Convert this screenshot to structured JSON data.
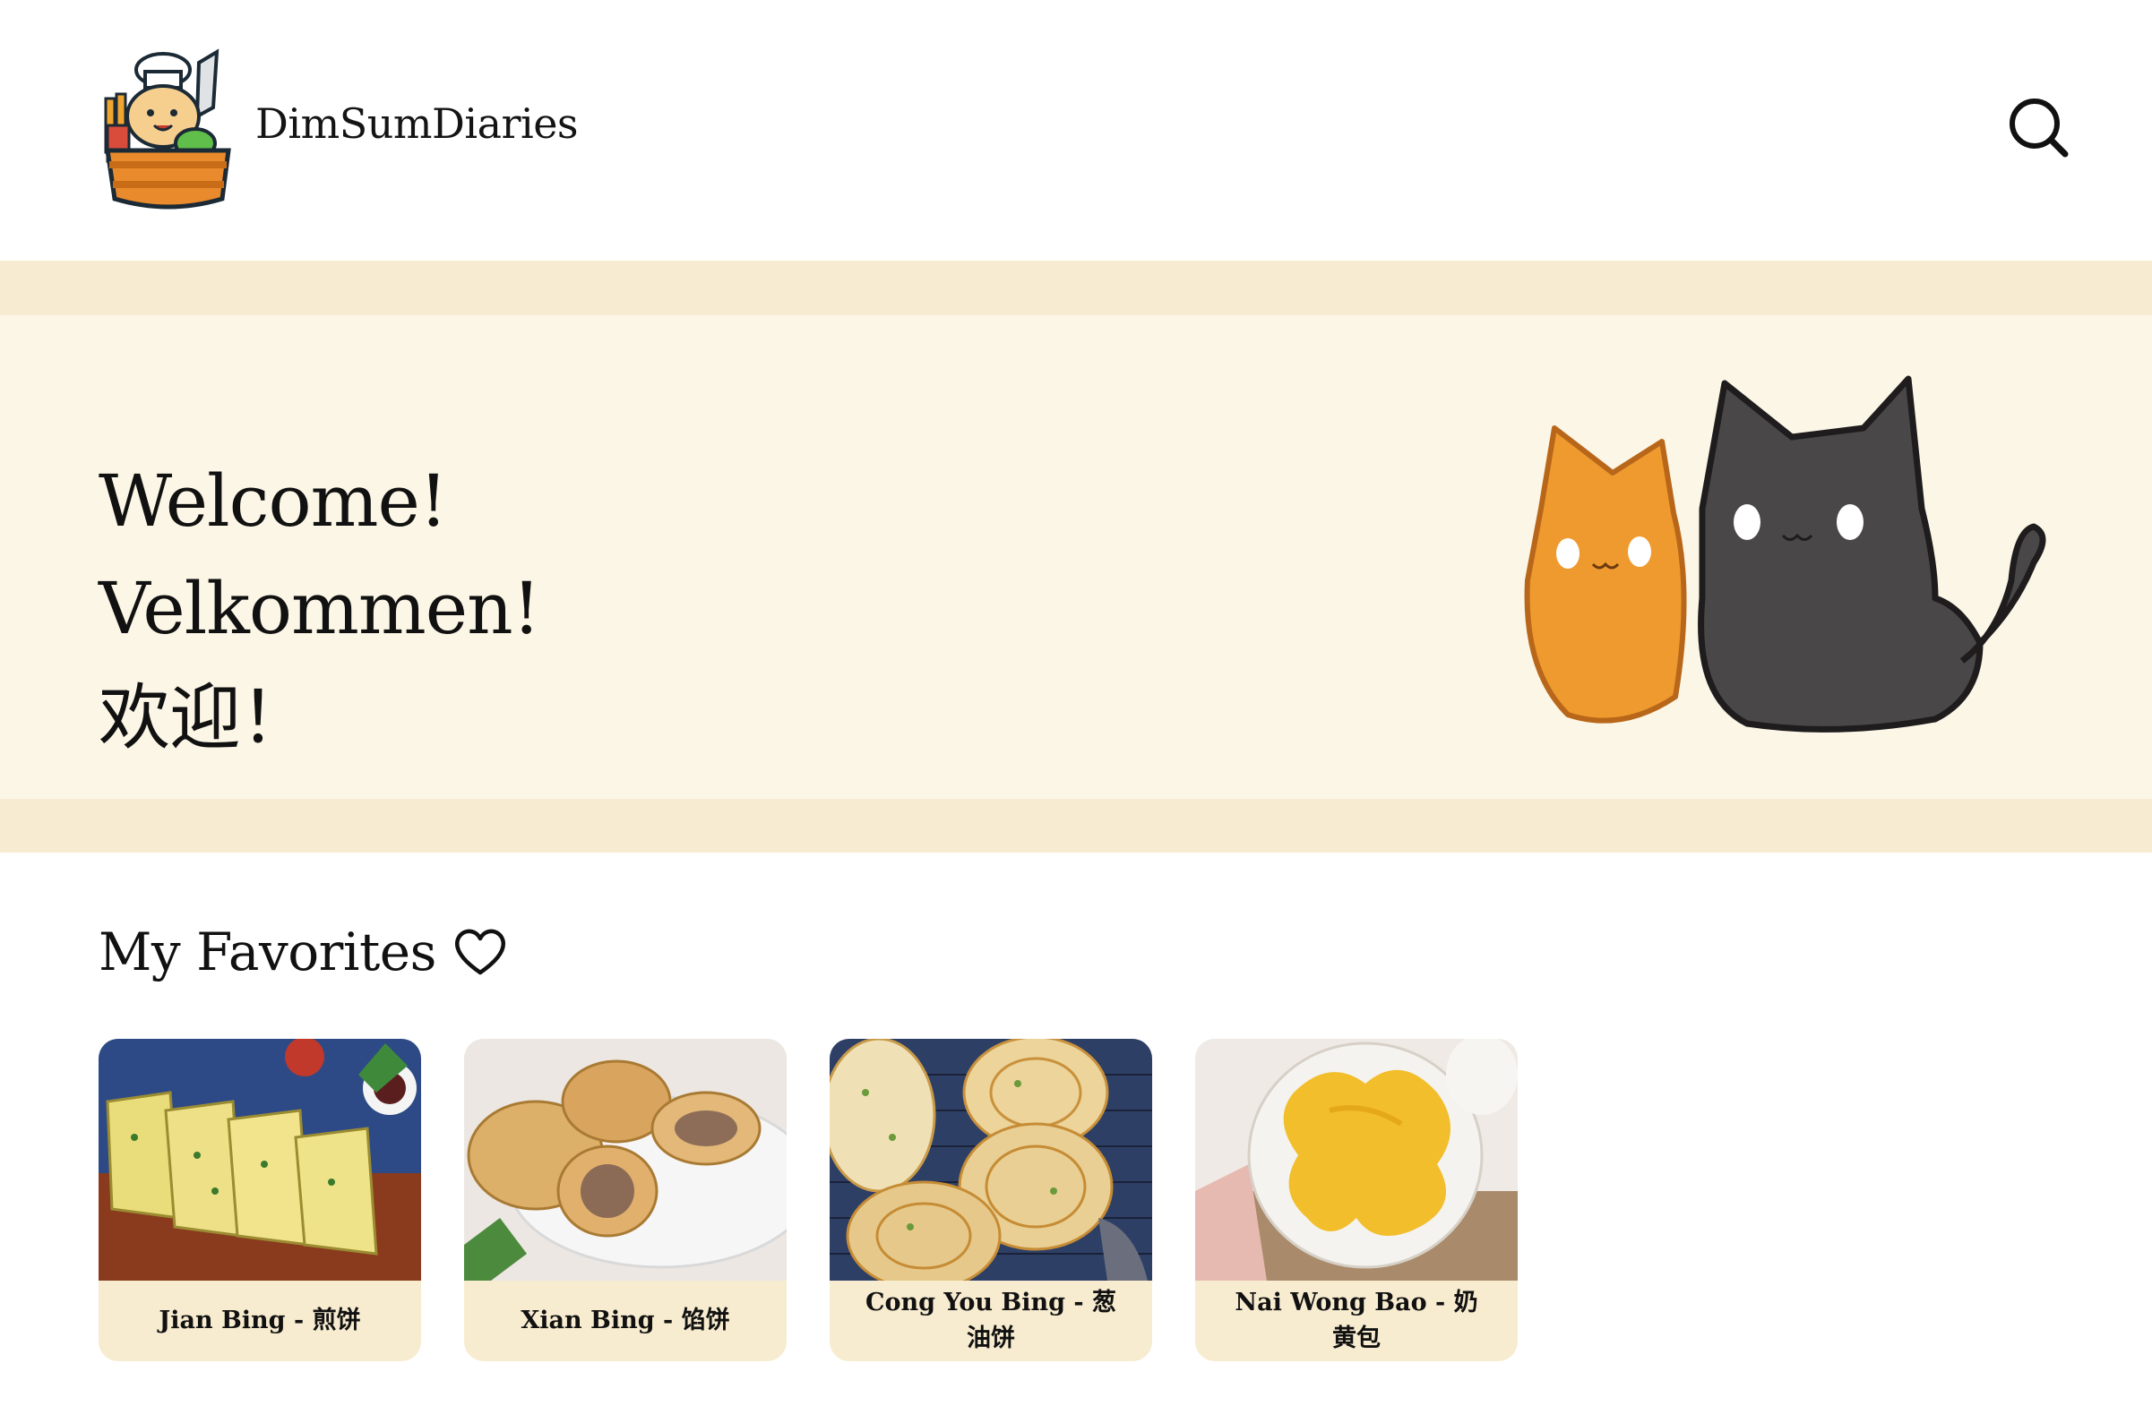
{
  "header": {
    "site_name": "DimSumDiaries",
    "logo_icon": "chef-dumpling-logo",
    "search_icon": "search-icon"
  },
  "hero": {
    "greetings": [
      "Welcome!",
      "Velkommen!",
      "欢迎！"
    ],
    "illustration": "two-cats-illustration"
  },
  "favorites": {
    "title": "My Favorites",
    "icon": "heart-icon",
    "cards": [
      {
        "label": "Jian Bing - 煎饼"
      },
      {
        "label": "Xian Bing - 馅饼"
      },
      {
        "label": "Cong You Bing - 葱油饼"
      },
      {
        "label": "Nai Wong Bao - 奶黄包"
      }
    ]
  },
  "colors": {
    "hero_band": "#f7ecd2",
    "hero_bg": "#fcf6e6",
    "card_label_bg": "#f8ecd0",
    "text": "#111111"
  }
}
